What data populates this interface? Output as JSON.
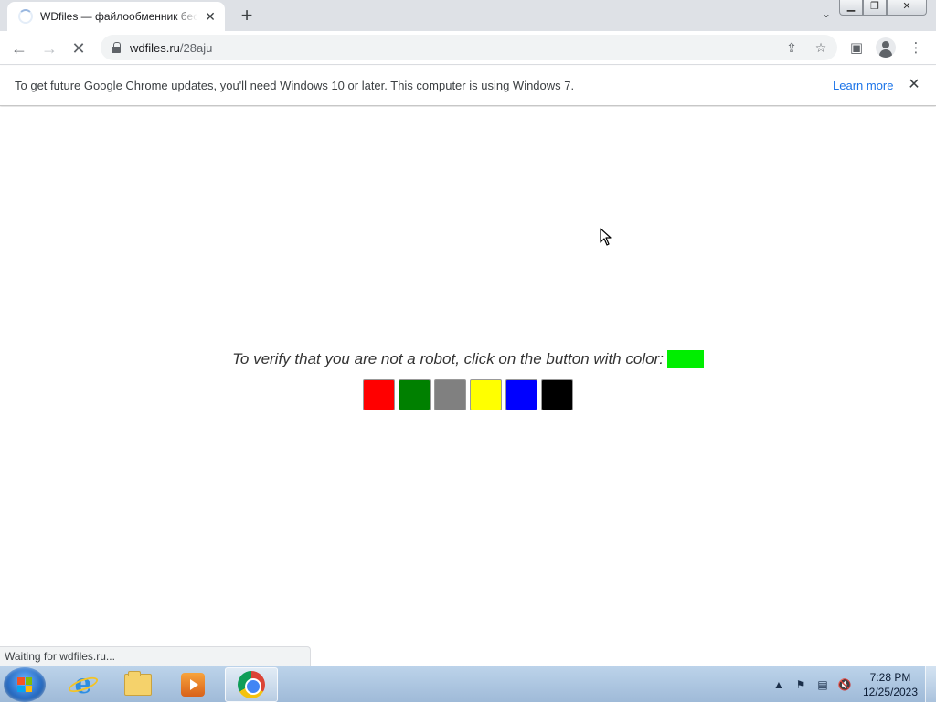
{
  "browser": {
    "tab": {
      "title": "WDfiles — файлообменник бесплатный",
      "close_glyph": "✕"
    },
    "new_tab_glyph": "+",
    "tab_search_glyph": "⌄",
    "window_controls": {
      "minimize": "▁",
      "restore": "❐",
      "close": "✕"
    },
    "toolbar": {
      "back_glyph": "←",
      "forward_glyph": "→",
      "stop_glyph": "✕",
      "url_host": "wdfiles.ru",
      "url_path": "/28aju",
      "share_glyph": "⇪",
      "bookmark_glyph": "☆",
      "side_panel_glyph": "▣",
      "menu_glyph": "⋮"
    },
    "infobar": {
      "message": "To get future Google Chrome updates, you'll need Windows 10 or later. This computer is using Windows 7.",
      "link": "Learn more",
      "close_glyph": "✕"
    },
    "status_text": "Waiting for wdfiles.ru..."
  },
  "page": {
    "verify_prompt": "To verify that you are not a robot, click on the button with color:",
    "target_color": "#00ee00",
    "color_buttons": [
      {
        "name": "red",
        "color": "#ff0000"
      },
      {
        "name": "green",
        "color": "#008000"
      },
      {
        "name": "gray",
        "color": "#808080"
      },
      {
        "name": "yellow",
        "color": "#ffff00"
      },
      {
        "name": "blue",
        "color": "#0000ff"
      },
      {
        "name": "black",
        "color": "#000000"
      }
    ]
  },
  "taskbar": {
    "tray": {
      "arrow_glyph": "▲",
      "flag_glyph": "⚑",
      "network_glyph": "▤",
      "volume_glyph": "🔇"
    },
    "clock_time": "7:28 PM",
    "clock_date": "12/25/2023"
  }
}
